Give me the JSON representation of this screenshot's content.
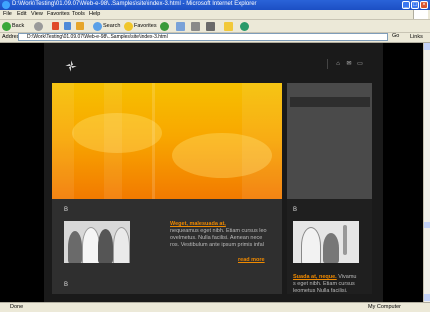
{
  "window": {
    "title": "D:\\Work\\Testing\\01.09.07\\Web-e-98\\..Samples\\site\\index-3.html - Microsoft Internet Explorer"
  },
  "menu": [
    "File",
    "Edit",
    "View",
    "Favorites",
    "Tools",
    "Help"
  ],
  "toolbar": {
    "back_label": "Back",
    "search_label": "Search",
    "favorites_label": "Favorites"
  },
  "address": {
    "label": "Address",
    "value": "D:\\Work\\Testing\\01.09.07\\Web-e-98\\..Samples\\site\\index-3.html",
    "go_label": "Go",
    "links_label": "Links"
  },
  "site": {
    "bullet1": "B",
    "bullet2": "B",
    "bullet3": "B",
    "article1": {
      "title": "Weget, malesuada at,",
      "lines": [
        "nequeamus eget nibh. Etiam cursus leo",
        "ovelmetus. Nulla facilisi. Aenean nece",
        "ros. Vestibulum ante ipsum primis infal"
      ],
      "readmore": "read more"
    },
    "article2": {
      "title": "Suada at, neque.",
      "title_rest": " Vivamu",
      "lines": [
        "s eget nibh. Etiam cursus",
        "leometus Nulla facilisi."
      ]
    }
  },
  "status": {
    "done_label": "Done",
    "zone_label": "My Computer"
  },
  "colors": {
    "accent": "#f08a00",
    "titlebar": "#1c4fc4"
  }
}
